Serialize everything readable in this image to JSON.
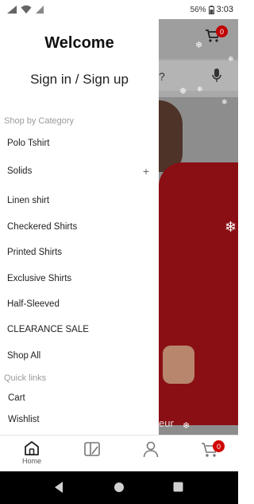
{
  "status_bar": {
    "battery": "56%",
    "time": "3:03"
  },
  "background_page": {
    "search_partial_text": "?",
    "cart_badge": "0",
    "hero_partial_text": "eur"
  },
  "drawer": {
    "welcome": "Welcome",
    "signin": "Sign in / Sign up",
    "shop_by_category_label": "Shop by Category",
    "categories": [
      {
        "label": "Polo Tshirt"
      },
      {
        "label": "Solids",
        "expand": "+"
      },
      {
        "label": "Linen shirt"
      },
      {
        "label": "Checkered Shirts"
      },
      {
        "label": "Printed Shirts"
      },
      {
        "label": "Exclusive Shirts"
      },
      {
        "label": "Half-Sleeved"
      },
      {
        "label": "CLEARANCE SALE"
      },
      {
        "label": "Shop All"
      }
    ],
    "quick_links_label": "Quick links",
    "quick_links": [
      {
        "label": "Cart"
      },
      {
        "label": "Wishlist"
      }
    ]
  },
  "bottom_nav": {
    "home_label": "Home",
    "cart_badge": "0"
  },
  "colors": {
    "badge": "#d00000",
    "shirt": "#8a0f14"
  }
}
